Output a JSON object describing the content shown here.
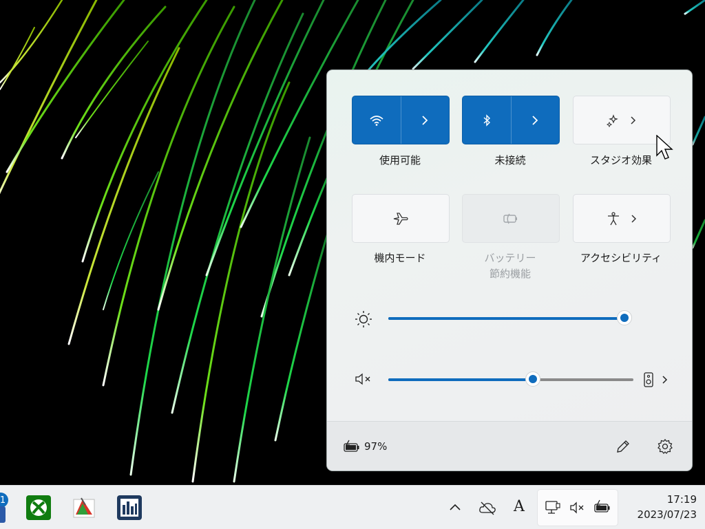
{
  "quick_settings": {
    "tiles": [
      {
        "id": "wifi",
        "label": "使用可能",
        "state": "on",
        "icon": "wifi-icon",
        "has_arrow": true
      },
      {
        "id": "bluetooth",
        "label": "未接続",
        "state": "on",
        "icon": "bluetooth-icon",
        "has_arrow": true
      },
      {
        "id": "studio-effects",
        "label": "スタジオ効果",
        "state": "off",
        "icon": "studio-effects-icon",
        "has_arrow": true
      },
      {
        "id": "airplane",
        "label": "機内モード",
        "state": "off",
        "icon": "airplane-icon",
        "has_arrow": false
      },
      {
        "id": "battery-saver",
        "label_line1": "バッテリー",
        "label_line2": "節約機能",
        "state": "disabled",
        "icon": "battery-saver-icon",
        "has_arrow": false
      },
      {
        "id": "accessibility",
        "label": "アクセシビリティ",
        "state": "off",
        "icon": "accessibility-icon",
        "has_arrow": true
      }
    ],
    "brightness": {
      "icon": "brightness-icon",
      "value_fraction": 1.0
    },
    "volume": {
      "icon": "volume-muted-icon",
      "value_fraction": 0.59,
      "output_icon": "speaker-device-icon"
    },
    "footer": {
      "battery_icon": "battery-charging-icon",
      "battery_percent": "97%",
      "edit_icon": "pencil-icon",
      "settings_icon": "gear-icon"
    }
  },
  "taskbar": {
    "apps": [
      {
        "name": "xbox",
        "icon": "xbox-icon"
      },
      {
        "name": "photo-app",
        "icon": "photo-app-icon"
      },
      {
        "name": "audio-app",
        "icon": "equalizer-app-icon"
      }
    ],
    "badge": "1",
    "tray": {
      "ime": "A",
      "time": "17:19",
      "date": "2023/07/23"
    }
  },
  "colors": {
    "accent": "#0f6cbd",
    "panel": "#eef1f1",
    "taskbar": "#eef0f2"
  }
}
